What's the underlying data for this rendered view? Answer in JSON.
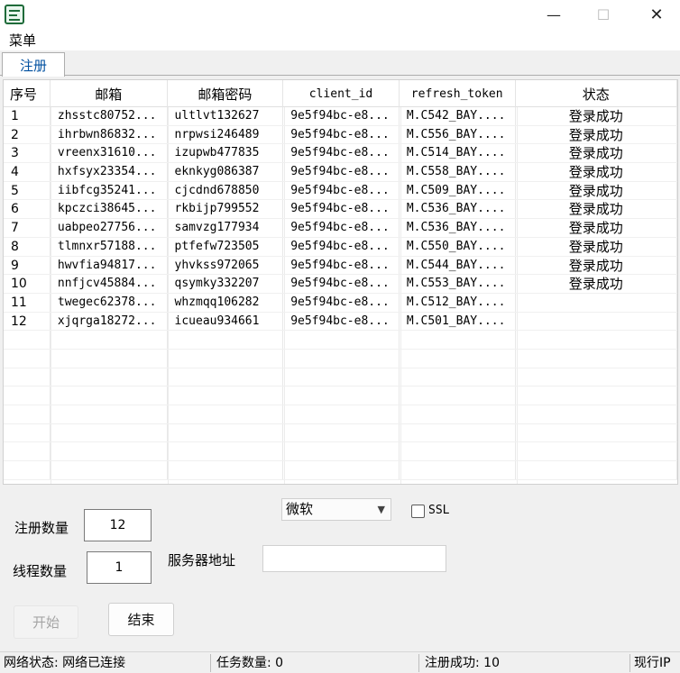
{
  "window": {
    "minimize_glyph": "—",
    "maximize_glyph": "☐",
    "close_glyph": "✕"
  },
  "menubar": {
    "menu_label": "菜单"
  },
  "tabs": [
    {
      "label": "注册",
      "selected": true
    }
  ],
  "table": {
    "columns": [
      "序号",
      "邮箱",
      "邮箱密码",
      "client_id",
      "refresh_token",
      "状态"
    ],
    "rows": [
      [
        "1",
        "zhsstc80752...",
        "ultlvt132627",
        "9e5f94bc-e8...",
        "M.C542_BAY....",
        "登录成功"
      ],
      [
        "2",
        "ihrbwn86832...",
        "nrpwsi246489",
        "9e5f94bc-e8...",
        "M.C556_BAY....",
        "登录成功"
      ],
      [
        "3",
        "vreenx31610...",
        "izupwb477835",
        "9e5f94bc-e8...",
        "M.C514_BAY....",
        "登录成功"
      ],
      [
        "4",
        "hxfsyx23354...",
        "eknkyg086387",
        "9e5f94bc-e8...",
        "M.C558_BAY....",
        "登录成功"
      ],
      [
        "5",
        "iibfcg35241...",
        "cjcdnd678850",
        "9e5f94bc-e8...",
        "M.C509_BAY....",
        "登录成功"
      ],
      [
        "6",
        "kpczci38645...",
        "rkbijp799552",
        "9e5f94bc-e8...",
        "M.C536_BAY....",
        "登录成功"
      ],
      [
        "7",
        "uabpeo27756...",
        "samvzg177934",
        "9e5f94bc-e8...",
        "M.C536_BAY....",
        "登录成功"
      ],
      [
        "8",
        "tlmnxr57188...",
        "ptfefw723505",
        "9e5f94bc-e8...",
        "M.C550_BAY....",
        "登录成功"
      ],
      [
        "9",
        "hwvfia94817...",
        "yhvkss972065",
        "9e5f94bc-e8...",
        "M.C544_BAY....",
        "登录成功"
      ],
      [
        "10",
        "nnfjcv45884...",
        "qsymky332207",
        "9e5f94bc-e8...",
        "M.C553_BAY....",
        "登录成功"
      ],
      [
        "11",
        "twegec62378...",
        "whzmqq106282",
        "9e5f94bc-e8...",
        "M.C512_BAY....",
        ""
      ],
      [
        "12",
        "xjqrga18272...",
        "icueau934661",
        "9e5f94bc-e8...",
        "M.C501_BAY....",
        ""
      ]
    ]
  },
  "controls": {
    "register_count_label": "注册数量",
    "register_count_value": "12",
    "thread_count_label": "线程数量",
    "thread_count_value": "1",
    "provider_selected": "微软",
    "ssl_label": "SSL",
    "ssl_checked": false,
    "server_label": "服务器地址",
    "server_value": "",
    "start_label": "开始",
    "start_enabled": false,
    "end_label": "结束"
  },
  "statusbar": {
    "network": "网络状态: 网络已连接",
    "tasks": "任务数量: 0",
    "success": "注册成功: 10",
    "ip": "现行IP"
  },
  "colors": {
    "tab_text": "#0050a0",
    "app_icon": "#1f6b3a",
    "disabled_text": "#a5a5a5"
  }
}
